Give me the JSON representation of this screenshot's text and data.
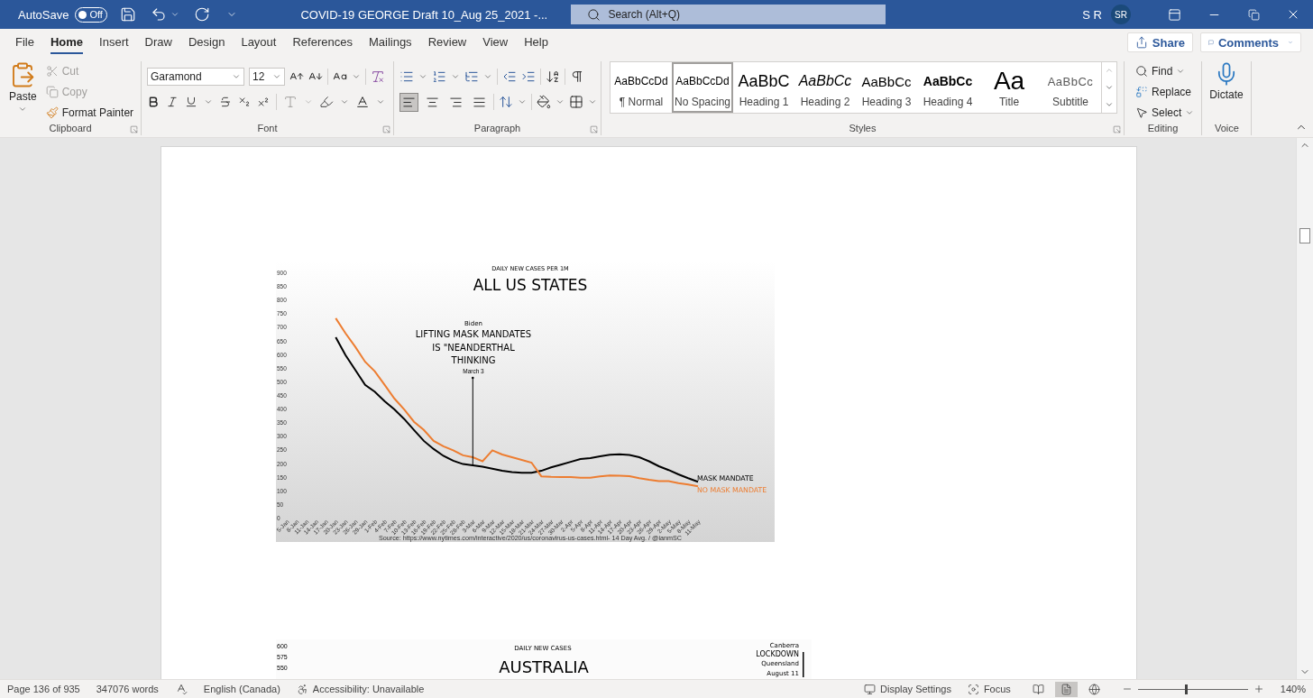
{
  "title_bar": {
    "autosave": {
      "label": "AutoSave",
      "on": false,
      "state_label": "Off"
    },
    "document_title": "COVID-19 GEORGE Draft 10_Aug 25_2021  -...",
    "search_placeholder": "Search (Alt+Q)",
    "user_name": "S R",
    "avatar": "SR"
  },
  "menu_tabs": [
    {
      "label": "File",
      "selected": false
    },
    {
      "label": "Home",
      "selected": true
    },
    {
      "label": "Insert",
      "selected": false
    },
    {
      "label": "Draw",
      "selected": false
    },
    {
      "label": "Design",
      "selected": false
    },
    {
      "label": "Layout",
      "selected": false
    },
    {
      "label": "References",
      "selected": false
    },
    {
      "label": "Mailings",
      "selected": false
    },
    {
      "label": "Review",
      "selected": false
    },
    {
      "label": "View",
      "selected": false
    },
    {
      "label": "Help",
      "selected": false
    }
  ],
  "share_button": "Share",
  "comments_button": "Comments",
  "clipboard": {
    "paste": "Paste",
    "cut": {
      "label": "Cut",
      "disabled": true
    },
    "copy": {
      "label": "Copy",
      "disabled": true
    },
    "format_painter": "Format Painter",
    "group_label": "Clipboard"
  },
  "font": {
    "font_name": "Garamond",
    "font_size": "12",
    "group_label": "Font"
  },
  "paragraph": {
    "alignments": [
      {
        "kind": "left",
        "selected": true
      },
      {
        "kind": "center",
        "selected": false
      },
      {
        "kind": "right",
        "selected": false
      },
      {
        "kind": "justify",
        "selected": false
      }
    ],
    "group_label": "Paragraph"
  },
  "styles": {
    "items": [
      {
        "kind": "normal",
        "preview": "AaBbCcDd",
        "label": "¶ Normal",
        "selected": false
      },
      {
        "kind": "normal",
        "preview": "AaBbCcDd",
        "label": "No Spacing",
        "selected": true
      },
      {
        "kind": "heading1",
        "preview": "AaBbC",
        "label": "Heading 1",
        "selected": false
      },
      {
        "kind": "heading2",
        "preview": "AaBbCc",
        "label": "Heading 2",
        "selected": false
      },
      {
        "kind": "heading3",
        "preview": "AaBbCc",
        "label": "Heading 3",
        "selected": false
      },
      {
        "kind": "heading4",
        "preview": "AaBbCc",
        "label": "Heading 4",
        "selected": false
      },
      {
        "kind": "title",
        "preview": "Aa",
        "label": "Title",
        "selected": false
      },
      {
        "kind": "subtitle",
        "preview": "AaBbCc",
        "label": "Subtitle",
        "selected": false
      }
    ],
    "group_label": "Styles"
  },
  "editing": {
    "find": "Find",
    "replace": "Replace",
    "select": "Select",
    "group_label": "Editing"
  },
  "voice": {
    "dictate": "Dictate",
    "group_label": "Voice"
  },
  "document": {
    "chart": {
      "supertitle": "DAILY NEW CASES PER 1M",
      "note": {
        "name": "Biden",
        "lines": [
          "LIFTING MASK MANDATES",
          "IS \"NEANDERTHAL",
          "THINKING"
        ],
        "date": "March 3"
      },
      "source": "Source: https://www.nytimes.com/interactive/2020/us/coronavirus-us-cases.html- 14 Day Avg. / @ianmSC",
      "chart_data": {
        "type": "line",
        "title": "ALL US STATES",
        "categories": [
          "5-Jan",
          "8-Jan",
          "11-Jan",
          "14-Jan",
          "17-Jan",
          "20-Jan",
          "23-Jan",
          "26-Jan",
          "29-Jan",
          "1-Feb",
          "4-Feb",
          "7-Feb",
          "10-Feb",
          "13-Feb",
          "16-Feb",
          "19-Feb",
          "22-Feb",
          "25-Feb",
          "28-Feb",
          "3-Mar",
          "6-Mar",
          "9-Mar",
          "12-Mar",
          "15-Mar",
          "18-Mar",
          "21-Mar",
          "24-Mar",
          "27-Mar",
          "30-Mar",
          "2-Apr",
          "5-Apr",
          "8-Apr",
          "11-Apr",
          "14-Apr",
          "17-Apr",
          "20-Apr",
          "23-Apr",
          "26-Apr",
          "29-Apr",
          "2-May",
          "5-May",
          "8-May",
          "11-May"
        ],
        "series": [
          {
            "name": "MASK MANDATE",
            "color": "#000000",
            "values": [
              null,
              null,
              null,
              null,
              null,
              665,
              600,
              545,
              490,
              465,
              430,
              400,
              365,
              325,
              285,
              255,
              230,
              212,
              200,
              195,
              190,
              183,
              175,
              170,
              168,
              168,
              175,
              188,
              198,
              208,
              218,
              222,
              228,
              234,
              236,
              233,
              225,
              210,
              192,
              178,
              162,
              148,
              135
            ]
          },
          {
            "name": "NO MASK MANDATE",
            "color": "#ed7d31",
            "values": [
              null,
              null,
              null,
              null,
              null,
              735,
              680,
              630,
              575,
              540,
              490,
              440,
              400,
              355,
              325,
              285,
              265,
              250,
              232,
              225,
              210,
              250,
              235,
              225,
              215,
              205,
              155,
              153,
              152,
              152,
              150,
              150,
              155,
              158,
              157,
              156,
              148,
              142,
              137,
              137,
              130,
              125,
              118
            ]
          }
        ],
        "ylim": [
          0,
          900
        ],
        "yticks": [
          0,
          50,
          100,
          150,
          200,
          250,
          300,
          350,
          400,
          450,
          500,
          550,
          600,
          650,
          700,
          750,
          800,
          850,
          900
        ]
      }
    },
    "second_chart": {
      "y_labels": [
        "600",
        "575",
        "550"
      ],
      "subtitle": "DAILY NEW CASES",
      "title": "AUSTRALIA",
      "labels": [
        "Canberra",
        "LOCKDOWN",
        "Queensland",
        "August 11"
      ]
    }
  },
  "status_bar": {
    "page": "Page 136 of 935",
    "words": "347076 words",
    "language": "English (Canada)",
    "accessibility": "Accessibility: Unavailable",
    "display_settings": "Display Settings",
    "focus": "Focus",
    "views": [
      {
        "kind": "read",
        "selected": false
      },
      {
        "kind": "print",
        "selected": true
      },
      {
        "kind": "web",
        "selected": false
      }
    ],
    "zoom": {
      "level": 0.43,
      "label": "140%"
    }
  }
}
